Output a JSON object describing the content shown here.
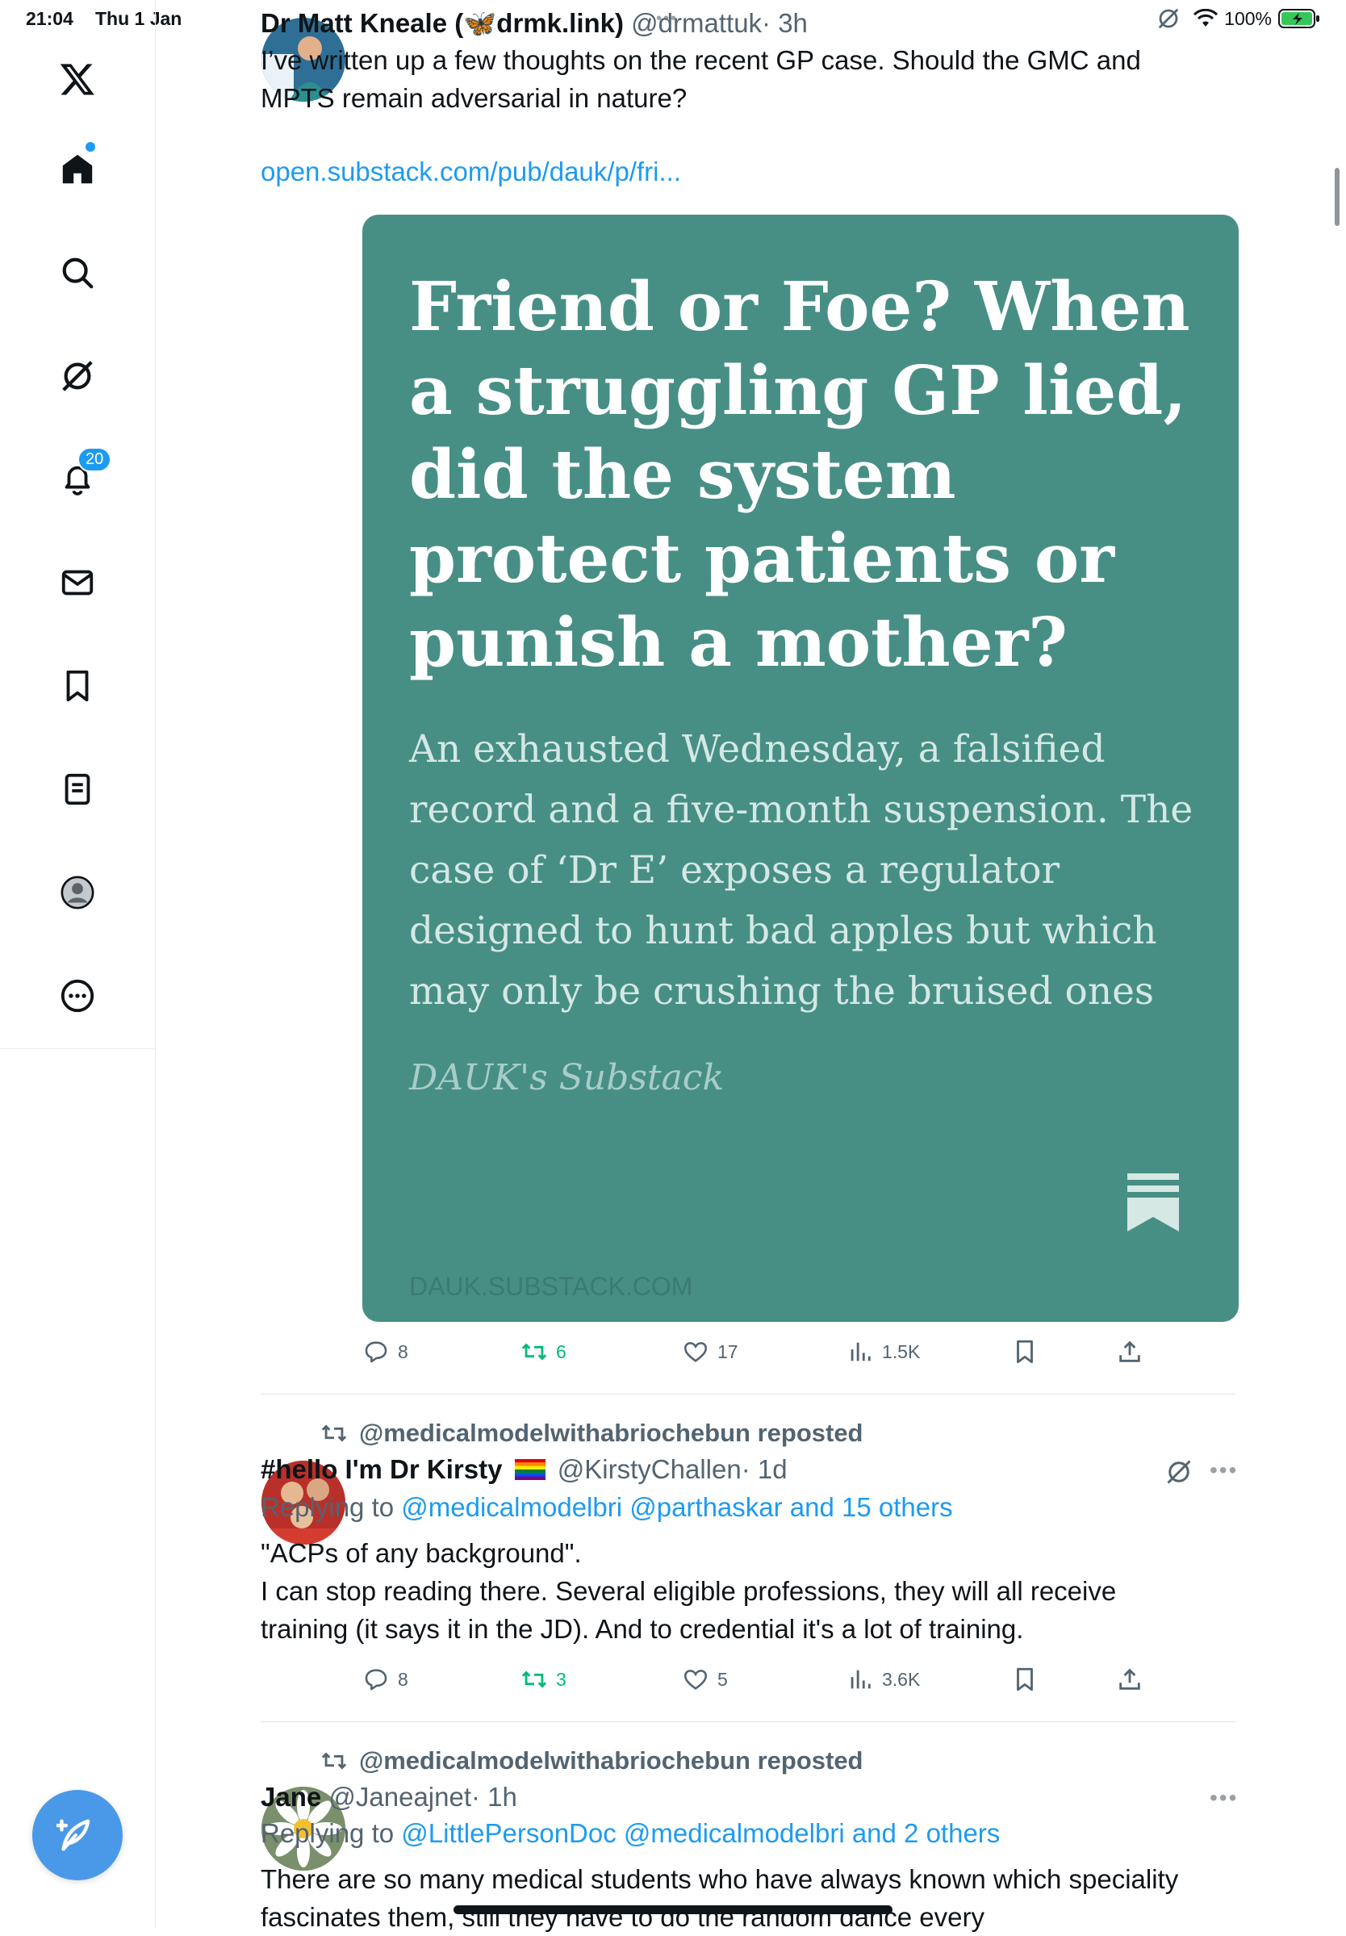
{
  "status": {
    "time": "21:04",
    "date": "Thu 1 Jan",
    "battery": "100%"
  },
  "sidebar": {
    "items": [
      {
        "id": "x-logo",
        "icon": "x-logo-icon"
      },
      {
        "id": "home",
        "icon": "home-icon"
      },
      {
        "id": "explore",
        "icon": "search-icon"
      },
      {
        "id": "grok",
        "icon": "grok-icon"
      },
      {
        "id": "notifications",
        "icon": "bell-icon",
        "badge": "20"
      },
      {
        "id": "messages",
        "icon": "mail-icon"
      },
      {
        "id": "bookmarks",
        "icon": "bookmark-icon"
      },
      {
        "id": "lists",
        "icon": "list-icon"
      },
      {
        "id": "profile",
        "icon": "profile-icon"
      },
      {
        "id": "more",
        "icon": "more-circle-icon"
      }
    ],
    "compose_icon": "compose-icon"
  },
  "tweet1": {
    "name": "Dr Matt Kneale (🦋drmk.link)",
    "handle": "@drmattuk",
    "time": "· 3h",
    "text": "I’ve written up a few thoughts on the recent GP case. Should the GMC and MPTS remain adversarial in nature?",
    "link": "open.substack.com/pub/dauk/p/fri...",
    "card": {
      "title": "Friend or Foe? When a struggling GP lied, did the system protect patients or punish a mother?",
      "subtitle": "An exhausted Wednesday, a falsified record and a five-month suspension. The case of ‘Dr E’ exposes a regulator designed to hunt bad apples but which may only be crushing the bruised ones",
      "brand": "DAUK's Substack",
      "url": "DAUK.SUBSTACK.COM"
    },
    "actions": {
      "replies": "8",
      "reposts": "6",
      "likes": "17",
      "views": "1.5K"
    }
  },
  "tweet2": {
    "repost_by": "@medicalmodelwithabriochebun reposted",
    "name": "#hello I'm Dr Kirsty",
    "flag": "🏳️‍🌈",
    "handle": "@KirstyChallen",
    "time": "· 1d",
    "replying_prefix": "Replying to",
    "replying_to": "@medicalmodelbri @parthaskar and 15 others",
    "text_line1": "\"ACPs of any background\".",
    "text_line2": "I can stop reading there. Several eligible professions, they will all receive training (it says it in the JD). And to credential it's a lot of training.",
    "actions": {
      "replies": "8",
      "reposts": "3",
      "likes": "5",
      "views": "3.6K"
    }
  },
  "tweet3": {
    "repost_by": "@medicalmodelwithabriochebun reposted",
    "name": "Jane",
    "handle": "@Janeajnet",
    "time": "· 1h",
    "replying_prefix": "Replying to",
    "replying_to": "@LittlePersonDoc @medicalmodelbri and 2 others",
    "text": "There are so many medical students who have always known which speciality fascinates them, still they have to do the random dance every"
  }
}
